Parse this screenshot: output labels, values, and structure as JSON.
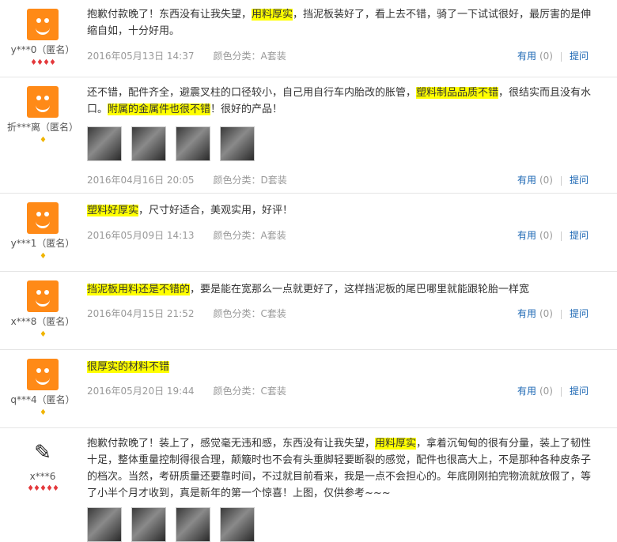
{
  "reviews": [
    {
      "user": "y***0（匿名）",
      "rank_icon": "red-diamond-x4",
      "segments": [
        {
          "text": "抱歉付款晚了！东西没有让我失望，",
          "hl": false
        },
        {
          "text": "用料厚实",
          "hl": true
        },
        {
          "text": "，挡泥板装好了，看上去不错，骑了一下试试很好，最厉害的是伸缩自如，十分好用。",
          "hl": false
        }
      ],
      "date": "2016年05月13日 14:37",
      "color": "颜色分类：A套装",
      "useful_label": "有用",
      "useful_count": "(0)",
      "ask_label": "提问"
    },
    {
      "user": "折***离（匿名）",
      "rank_icon": "gold-diamond-x1",
      "segments": [
        {
          "text": "还不错，配件齐全，避震叉柱的口径较小，自己用自行车内胎改的胀管，",
          "hl": false
        },
        {
          "text": "塑料制品品质不错",
          "hl": true
        },
        {
          "text": "，很结实而且没有水口。",
          "hl": false
        },
        {
          "text": "附属的金属件也很不错",
          "hl": true
        },
        {
          "text": "！很好的产品！",
          "hl": false
        }
      ],
      "photos": 4,
      "date": "2016年04月16日 20:05",
      "color": "颜色分类：D套装",
      "useful_label": "有用",
      "useful_count": "(0)",
      "ask_label": "提问"
    },
    {
      "user": "y***1（匿名）",
      "rank_icon": "gold-diamond-x1",
      "segments": [
        {
          "text": "塑料好厚实",
          "hl": true
        },
        {
          "text": "，尺寸好适合，美观实用，好评！",
          "hl": false
        }
      ],
      "date": "2016年05月09日 14:13",
      "color": "颜色分类：A套装",
      "useful_label": "有用",
      "useful_count": "(0)",
      "ask_label": "提问"
    },
    {
      "user": "x***8（匿名）",
      "rank_icon": "gold-diamond-x1",
      "segments": [
        {
          "text": "挡泥板用料还是不错的",
          "hl": true
        },
        {
          "text": "，要是能在宽那么一点就更好了，这样挡泥板的尾巴哪里就能跟轮胎一样宽",
          "hl": false
        }
      ],
      "date": "2016年04月15日 21:52",
      "color": "颜色分类：C套装",
      "useful_label": "有用",
      "useful_count": "(0)",
      "ask_label": "提问"
    },
    {
      "user": "q***4（匿名）",
      "rank_icon": "gold-diamond-x1",
      "segments": [
        {
          "text": "很厚实的材料不错",
          "hl": true
        }
      ],
      "date": "2016年05月20日 19:44",
      "color": "颜色分类：C套装",
      "useful_label": "有用",
      "useful_count": "(0)",
      "ask_label": "提问"
    },
    {
      "user": "x***6",
      "rank_icon": "red-diamond-x5",
      "segments": [
        {
          "text": "抱歉付款晚了！装上了，感觉毫无违和感，东西没有让我失望，",
          "hl": false
        },
        {
          "text": "用料厚实",
          "hl": true
        },
        {
          "text": "，拿着沉甸甸的很有分量，装上了韧性十足，整体重量控制得很合理，颠簸时也不会有头重脚轻要断裂的感觉，配件也很高大上，不是那种各种皮条子的档次。当然，考研质量还要靠时间，不过就目前看来，我是一点不会担心的。年底刚刚拍完物流就放假了，等了小半个月才收到，真是新年的第一个惊喜！上图，仅供参考~~~",
          "hl": false
        }
      ],
      "photos": 4
    }
  ]
}
